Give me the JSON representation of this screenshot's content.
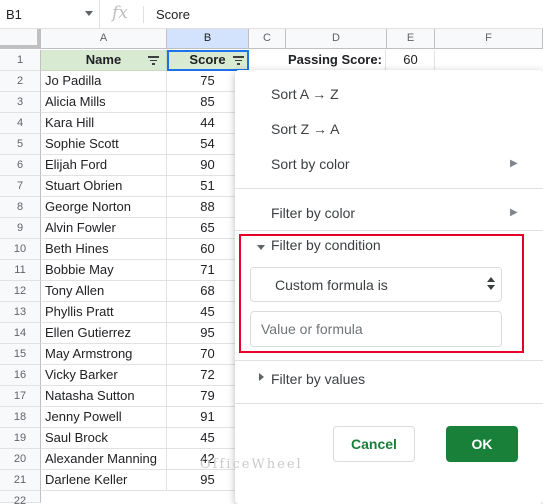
{
  "formula_bar": {
    "cell_ref": "B1",
    "fx_label": "fx",
    "content": "Score"
  },
  "columns": [
    "A",
    "B",
    "C",
    "D",
    "E",
    "F"
  ],
  "selected_column": "B",
  "header_row": {
    "name": "Name",
    "score": "Score"
  },
  "passing": {
    "label": "Passing Score:",
    "value": "60"
  },
  "rows": [
    {
      "num": "1"
    },
    {
      "num": "2",
      "name": "Jo Padilla",
      "score": "75"
    },
    {
      "num": "3",
      "name": "Alicia Mills",
      "score": "85"
    },
    {
      "num": "4",
      "name": "Kara Hill",
      "score": "44"
    },
    {
      "num": "5",
      "name": "Sophie Scott",
      "score": "54"
    },
    {
      "num": "6",
      "name": "Elijah Ford",
      "score": "90"
    },
    {
      "num": "7",
      "name": "Stuart Obrien",
      "score": "51"
    },
    {
      "num": "8",
      "name": "George Norton",
      "score": "88"
    },
    {
      "num": "9",
      "name": "Alvin Fowler",
      "score": "65"
    },
    {
      "num": "10",
      "name": "Beth Hines",
      "score": "60"
    },
    {
      "num": "11",
      "name": "Bobbie May",
      "score": "71"
    },
    {
      "num": "12",
      "name": "Tony Allen",
      "score": "68"
    },
    {
      "num": "13",
      "name": "Phyllis Pratt",
      "score": "45"
    },
    {
      "num": "14",
      "name": "Ellen Gutierrez",
      "score": "95"
    },
    {
      "num": "15",
      "name": "May Armstrong",
      "score": "70"
    },
    {
      "num": "16",
      "name": "Vicky Barker",
      "score": "72"
    },
    {
      "num": "17",
      "name": "Natasha Sutton",
      "score": "79"
    },
    {
      "num": "18",
      "name": "Jenny Powell",
      "score": "91"
    },
    {
      "num": "19",
      "name": "Saul Brock",
      "score": "45"
    },
    {
      "num": "20",
      "name": "Alexander Manning",
      "score": "42"
    },
    {
      "num": "21",
      "name": "Darlene Keller",
      "score": "95"
    },
    {
      "num": "22"
    }
  ],
  "menu": {
    "sort_az": "Sort A → Z",
    "sort_za": "Sort Z → A",
    "sort_by_color": "Sort by color",
    "filter_by_color": "Filter by color",
    "filter_by_condition": "Filter by condition",
    "condition_selected": "Custom formula is",
    "value_placeholder": "Value or formula",
    "filter_by_values": "Filter by values",
    "cancel": "Cancel",
    "ok": "OK"
  },
  "watermark": "OfficeWheel",
  "colors": {
    "header_fill": "#d9ead3",
    "selection_blue": "#1a73e8",
    "ok_green": "#188038",
    "highlight_red": "#e4002b"
  }
}
